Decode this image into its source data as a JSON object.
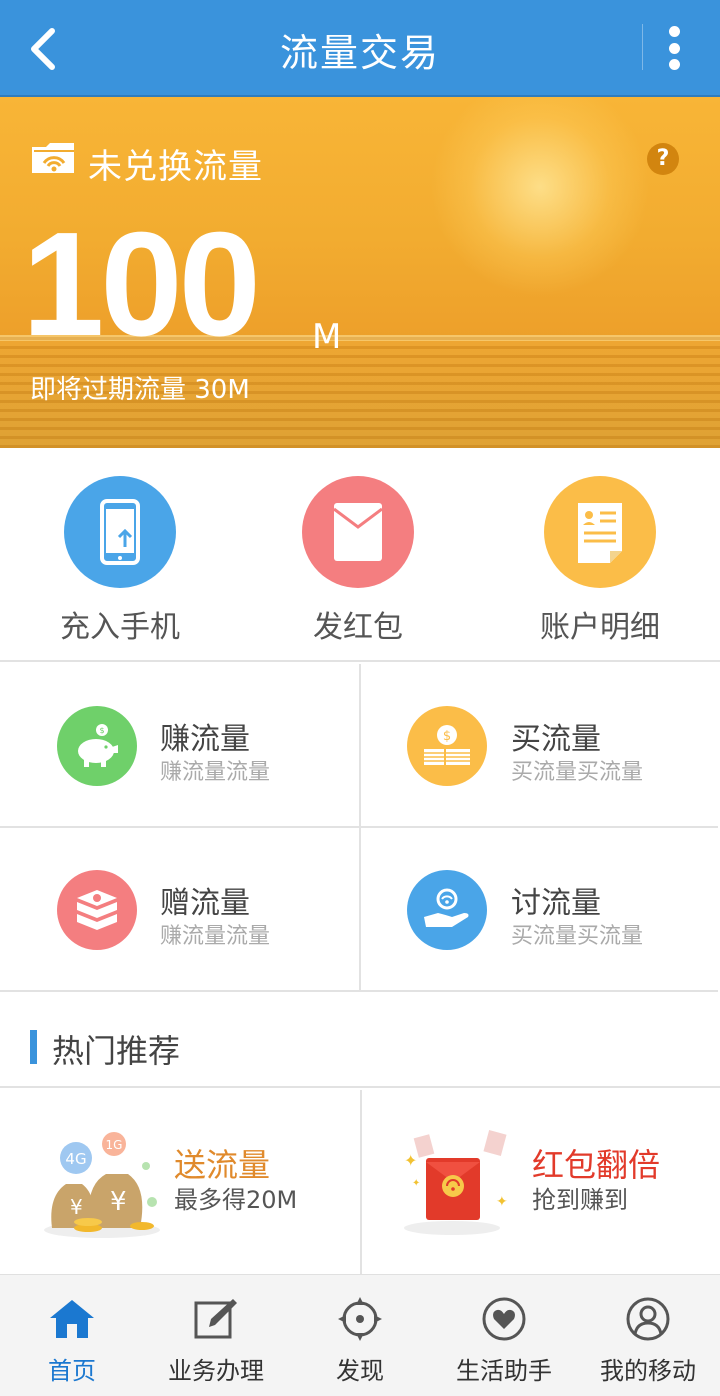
{
  "header": {
    "title": "流量交易"
  },
  "banner": {
    "label": "未兑换流量",
    "help": "?",
    "amount": "100",
    "unit": "M",
    "expiring_text": "即将过期流量 30M"
  },
  "quick_actions": [
    {
      "label": "充入手机",
      "color": "#4aa5e8",
      "icon": "phone-upload-icon"
    },
    {
      "label": "发红包",
      "color": "#f47e80",
      "icon": "envelope-icon"
    },
    {
      "label": "账户明细",
      "color": "#fbbd48",
      "icon": "document-icon"
    }
  ],
  "services": [
    {
      "title": "赚流量",
      "subtitle": "赚流量流量",
      "color": "#6fd06a",
      "icon": "piggy-bank-icon"
    },
    {
      "title": "买流量",
      "subtitle": "买流量买流量",
      "color": "#fbbd48",
      "icon": "money-stack-icon"
    },
    {
      "title": "赠流量",
      "subtitle": "赚流量流量",
      "color": "#f47e80",
      "icon": "gift-box-icon"
    },
    {
      "title": "讨流量",
      "subtitle": "买流量买流量",
      "color": "#4aa5e8",
      "icon": "hand-wifi-icon"
    }
  ],
  "hot": {
    "heading": "热门推荐",
    "items": [
      {
        "title": "送流量",
        "subtitle": "最多得20M",
        "title_color": "#e08a2c",
        "badges": [
          "4G",
          "1G"
        ]
      },
      {
        "title": "红包翻倍",
        "subtitle": "抢到赚到",
        "title_color": "#e23a2a"
      }
    ]
  },
  "tabs": [
    {
      "label": "首页",
      "icon": "home-icon",
      "active": true
    },
    {
      "label": "业务办理",
      "icon": "edit-icon",
      "active": false
    },
    {
      "label": "发现",
      "icon": "compass-icon",
      "active": false
    },
    {
      "label": "生活助手",
      "icon": "heart-icon",
      "active": false
    },
    {
      "label": "我的移动",
      "icon": "user-icon",
      "active": false
    }
  ],
  "colors": {
    "brand": "#3a93dc",
    "active_tab": "#1b78d0"
  }
}
